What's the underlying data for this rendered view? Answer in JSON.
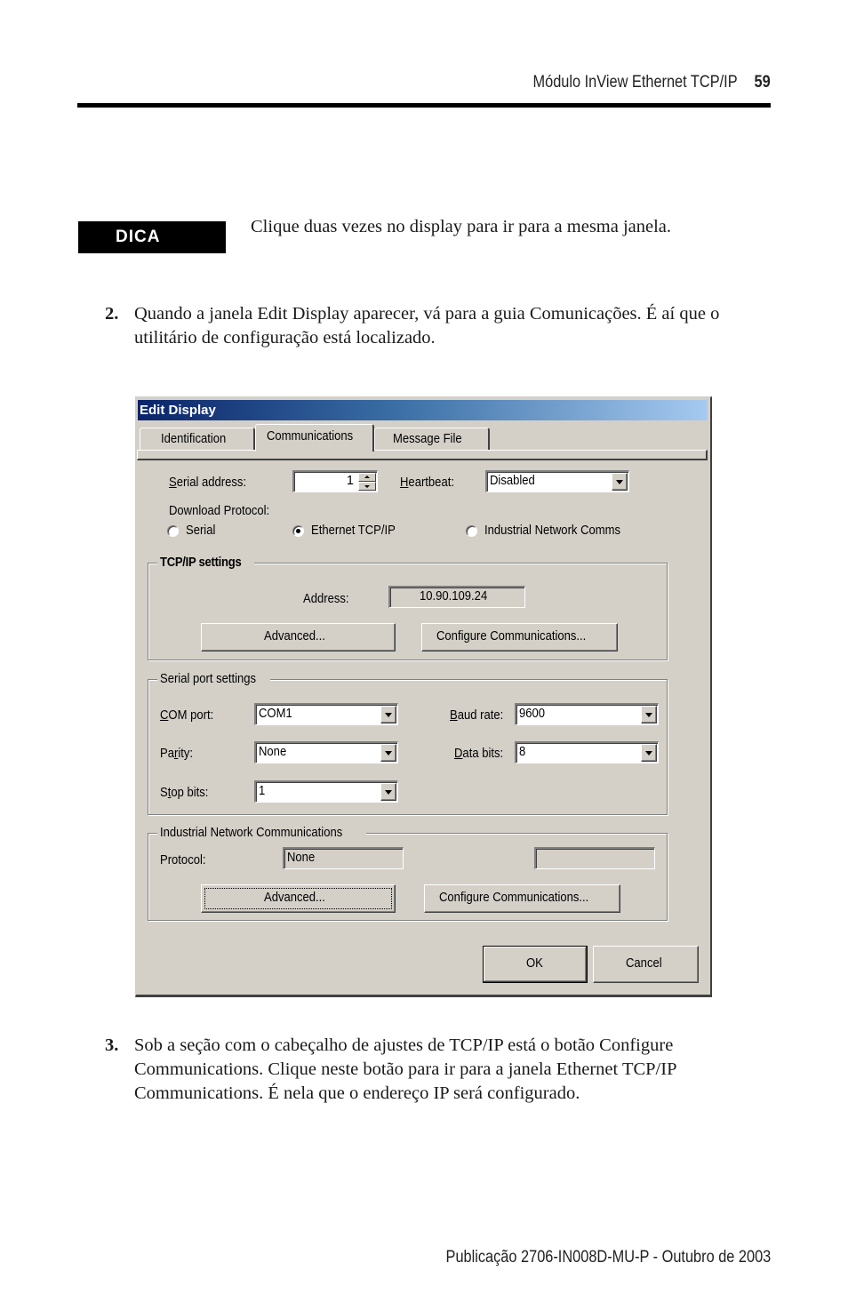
{
  "header": {
    "running_title": "Módulo InView Ethernet TCP/IP",
    "page_number": "59"
  },
  "tip": {
    "badge": "DICA",
    "text": "Clique duas vezes no display para ir para a mesma janela."
  },
  "steps": [
    {
      "number": "2.",
      "text": "Quando a janela Edit Display aparecer, vá para a guia Comunicações. É aí que o utilitário de configuração está localizado."
    },
    {
      "number": "3.",
      "text": "Sob a seção com o cabeçalho de ajustes de TCP/IP está o botão Configure Communications. Clique neste botão para ir para a janela Ethernet TCP/IP Communications. É nela que o endereço IP será configurado."
    }
  ],
  "dialog": {
    "title": "Edit Display",
    "tabs": [
      {
        "label": "Identification",
        "active": false
      },
      {
        "label": "Communications",
        "active": true
      },
      {
        "label": "Message File",
        "active": false
      }
    ],
    "serial_address": {
      "label_u": "S",
      "label_rest": "erial address:",
      "value": "1"
    },
    "heartbeat": {
      "label_u": "H",
      "label_rest": "eartbeat:",
      "value": "Disabled"
    },
    "download_protocol": {
      "label": "Download Protocol:",
      "options": [
        {
          "label": "Serial",
          "checked": false
        },
        {
          "label": "Ethernet TCP/IP",
          "checked": true
        },
        {
          "label": "Industrial Network Comms",
          "checked": false
        }
      ]
    },
    "tcpip": {
      "title": "TCP/IP settings",
      "address_label": "Address:",
      "address_value": "10.90.109.24",
      "advanced_button": "Advanced...",
      "configure_button": "Configure Communications..."
    },
    "serial_port": {
      "title": "Serial port settings",
      "com_port": {
        "label_u": "C",
        "label_rest": "OM port:",
        "value": "COM1"
      },
      "parity": {
        "label_pre": "Pa",
        "label_u": "r",
        "label_rest": "ity:",
        "value": "None"
      },
      "stop_bits": {
        "label_pre": "S",
        "label_u": "t",
        "label_rest": "op bits:",
        "value": "1"
      },
      "baud_rate": {
        "label_u": "B",
        "label_rest": "aud rate:",
        "value": "9600"
      },
      "data_bits": {
        "label_u": "D",
        "label_rest": "ata bits:",
        "value": "8"
      }
    },
    "industrial": {
      "title": "Industrial Network Communications",
      "protocol_label": "Protocol:",
      "protocol_value": "None",
      "secondary_value": "",
      "advanced_button": "Advanced...",
      "configure_button": "Configure Communications..."
    },
    "ok_button": "OK",
    "cancel_button": "Cancel",
    "colors": {
      "face": "#d4d0c8",
      "title_start": "#0a246a",
      "title_end": "#a6caf0"
    }
  },
  "footer": {
    "publication": "Publicação 2706-IN008D-MU-P - Outubro de 2003"
  }
}
